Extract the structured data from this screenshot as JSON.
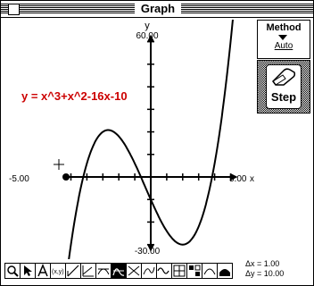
{
  "window": {
    "title": "Graph"
  },
  "method": {
    "label": "Method",
    "value": "Auto"
  },
  "step": {
    "label": "Step"
  },
  "graph": {
    "y_axis_label": "y",
    "x_axis_label": "x",
    "ymax_label": "60.00",
    "ymin_label": "-30.00",
    "xmin_label": "-5.00",
    "xmax_label": "5.00",
    "equation": "y = x^3+x^2-16x-10",
    "equation_color": "#cc0000"
  },
  "deltas": {
    "dx": "Δx = 1.00",
    "dy": "Δy = 10.00"
  },
  "toolbar": {
    "tools": [
      {
        "name": "zoom-tool-icon"
      },
      {
        "name": "arrow-tool-icon"
      },
      {
        "name": "text-tool-icon"
      },
      {
        "name": "point-coordinates-tool-icon"
      },
      {
        "name": "line-tool-icon"
      },
      {
        "name": "slope-tool-icon"
      },
      {
        "name": "tangent-tool-icon"
      },
      {
        "name": "root-tool-icon"
      },
      {
        "name": "intersection-tool-icon"
      },
      {
        "name": "function-tool-icon"
      },
      {
        "name": "wave-tool-icon"
      },
      {
        "name": "table-tool-icon"
      },
      {
        "name": "data-tool-icon"
      },
      {
        "name": "curve-tool-icon"
      },
      {
        "name": "area-tool-icon"
      }
    ],
    "active_index": 7
  }
}
